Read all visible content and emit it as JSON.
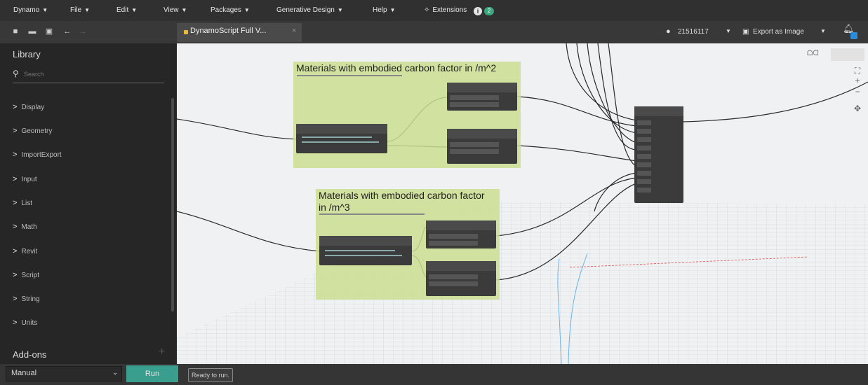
{
  "menubar": {
    "items": [
      {
        "label": "Dynamo"
      },
      {
        "label": "File"
      },
      {
        "label": "Edit"
      },
      {
        "label": "View"
      },
      {
        "label": "Packages"
      },
      {
        "label": "Generative Design"
      },
      {
        "label": "Help"
      },
      {
        "label": "Extensions"
      }
    ],
    "notification_count": "2"
  },
  "tab": {
    "label": "DynamoScript Full V...",
    "close": "×"
  },
  "account": {
    "user": "21516117",
    "export_label": "Export as Image"
  },
  "library": {
    "title": "Library",
    "search_placeholder": "Search",
    "categories": [
      "Display",
      "Geometry",
      "ImportExport",
      "Input",
      "List",
      "Math",
      "Revit",
      "Script",
      "String",
      "Units"
    ],
    "addons_label": "Add-ons"
  },
  "bottombar": {
    "run_mode": "Manual",
    "run_label": "Run",
    "status": "Ready to run."
  },
  "canvas": {
    "groups": [
      {
        "title": "Materials with embodied carbon factor in /m^2"
      },
      {
        "title": "Materials with embodied carbon factor in /m^3"
      }
    ]
  },
  "colors": {
    "accent": "#3a9e8e",
    "group": "#cbdf92",
    "toolbar": "#303030"
  }
}
